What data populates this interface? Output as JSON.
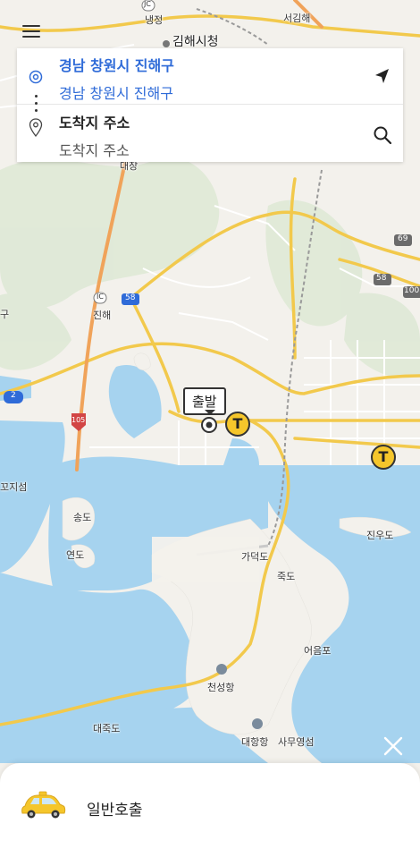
{
  "search": {
    "origin_title": "경남 창원시 진해구",
    "origin_subtitle": "경남 창원시 진해구",
    "dest_title": "도착지 주소",
    "dest_subtitle": "도착지 주소"
  },
  "map": {
    "start_label": "출발",
    "taxi_marker_letter": "T",
    "labels": {
      "nengjeong": "냉정",
      "gimhae_city_hall": "김해시청",
      "seogimhae": "서김해",
      "jinhae": "진해",
      "kkojiseom": "꼬지섬",
      "songdo": "송도",
      "yeondo": "연도",
      "gadeokdo": "가덕도",
      "jukdo": "죽도",
      "jinudo": "진우도",
      "eoeumpo": "어음포",
      "cheonseonghang": "천성항",
      "daejukdo": "대죽도",
      "daehanghang": "대항항",
      "samuyeongseom": "사무영섬",
      "daejang": "대장",
      "ic": "IC",
      "jc": "JC",
      "gu": "구",
      "route_58": "58",
      "route_58b": "58",
      "route_69": "69",
      "route_100": "100",
      "route_105": "105",
      "route_2": "2"
    },
    "colors": {
      "water": "#a6d3ef",
      "land": "#f3f1ec",
      "road_major": "#f2c94c",
      "road_expressway": "#f0a35a",
      "taxi": "#f5c62b"
    }
  },
  "bottom_sheet": {
    "option_label": "일반호출"
  }
}
